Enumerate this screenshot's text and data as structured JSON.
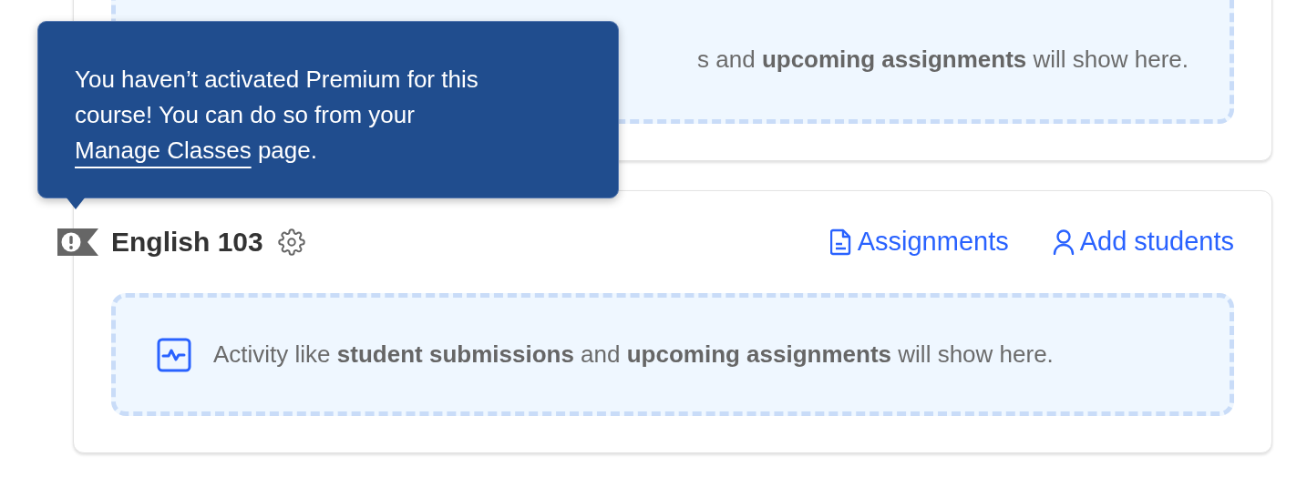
{
  "cards": [
    {
      "activity_text": "s and **upcoming assignments** will show here."
    },
    {
      "title": "English 103",
      "premium_warning": true,
      "links": [
        {
          "kind": "assignments",
          "label": "Assignments"
        },
        {
          "kind": "students",
          "label": "Add students"
        }
      ],
      "activity_text": "Activity like **student submissions** and **upcoming assignments** will show here."
    }
  ],
  "tooltip": {
    "text_before": "You haven’t activated Premium for this course! You can do so from your ",
    "link": "Manage Classes",
    "text_after": " page."
  }
}
